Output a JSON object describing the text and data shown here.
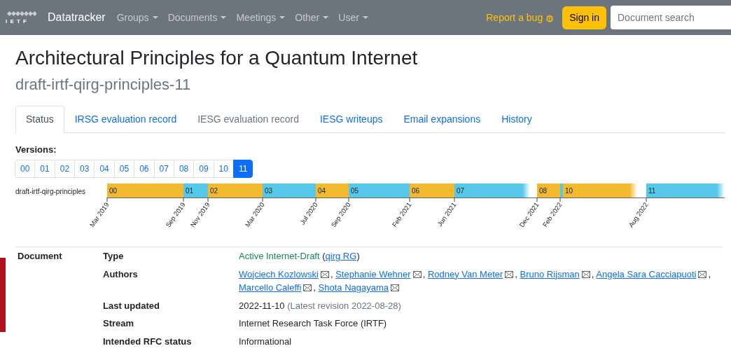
{
  "navbar": {
    "logo_text": "I E T F",
    "brand": "Datatracker",
    "menus": [
      "Groups",
      "Documents",
      "Meetings",
      "Other",
      "User"
    ],
    "report_bug": "Report a bug",
    "sign_in": "Sign in",
    "search": {
      "placeholder": "Document search"
    }
  },
  "title": "Architectural Principles for a Quantum Internet",
  "subtitle": "draft-irtf-qirg-principles-11",
  "tabs": [
    {
      "label": "Status",
      "selected": true,
      "disabled": false
    },
    {
      "label": "IRSG evaluation record",
      "selected": false,
      "disabled": false
    },
    {
      "label": "IESG evaluation record",
      "selected": false,
      "disabled": true
    },
    {
      "label": "IESG writeups",
      "selected": false,
      "disabled": false
    },
    {
      "label": "Email expansions",
      "selected": false,
      "disabled": false
    },
    {
      "label": "History",
      "selected": false,
      "disabled": false
    }
  ],
  "versions": {
    "label": "Versions:",
    "items": [
      {
        "label": "00",
        "selected": false
      },
      {
        "label": "01",
        "selected": false
      },
      {
        "label": "02",
        "selected": false
      },
      {
        "label": "03",
        "selected": false
      },
      {
        "label": "04",
        "selected": false
      },
      {
        "label": "05",
        "selected": false
      },
      {
        "label": "06",
        "selected": false
      },
      {
        "label": "07",
        "selected": false
      },
      {
        "label": "08",
        "selected": false
      },
      {
        "label": "09",
        "selected": false
      },
      {
        "label": "10",
        "selected": false
      },
      {
        "label": "11",
        "selected": true
      }
    ]
  },
  "timeline": {
    "name": "draft-irtf-qirg-principles",
    "segments": [
      {
        "label": "00",
        "color": "#f3ba2f",
        "fade": false
      },
      {
        "label": "01",
        "color": "#56c8ea",
        "fade": false
      },
      {
        "label": "02",
        "color": "#f3ba2f",
        "fade": false
      },
      {
        "label": "03",
        "color": "#56c8ea",
        "fade": false
      },
      {
        "label": "04",
        "color": "#f3ba2f",
        "fade": false
      },
      {
        "label": "05",
        "color": "#56c8ea",
        "fade": false
      },
      {
        "label": "06",
        "color": "#f3ba2f",
        "fade": false
      },
      {
        "label": "07",
        "color": "#56c8ea",
        "fade": true
      },
      {
        "label": "08",
        "color": "#f3ba2f",
        "fade": false
      },
      {
        "color": "#56c8ea"
      },
      {
        "label": "10",
        "color": "#f3ba2f",
        "fade": true
      },
      {
        "label": "11",
        "color": "#56c8ea",
        "fade": true
      }
    ],
    "ticks": [
      "Mar 2019",
      "Sep 2019",
      "Nov 2019",
      "Mar 2020",
      "Jul 2020",
      "Sep 2020",
      "Feb 2021",
      "Jun 2021",
      "Dec 2021",
      "Feb 2022",
      "Aug 2022"
    ]
  },
  "info": {
    "section": "Document",
    "rows": [
      {
        "kind": "type",
        "label": "Type",
        "parts": [
          {
            "kind": "status",
            "text": "Active Internet-Draft"
          },
          {
            "kind": "plain",
            "text": "("
          },
          {
            "kind": "link",
            "text": "qirg RG"
          },
          {
            "kind": "plain",
            "text": ")"
          }
        ]
      },
      {
        "kind": "authors",
        "label": "Authors",
        "authors": [
          {
            "name": "Wojciech Kozlowski",
            "sep": ","
          },
          {
            "name": "Stephanie Wehner",
            "sep": ","
          },
          {
            "name": "Rodney Van Meter",
            "sep": ","
          },
          {
            "name": "Bruno Rijsman",
            "sep": ","
          },
          {
            "name": "Angela Sara Cacciapuoti",
            "sep": ","
          },
          {
            "name": "Marcello Caleffi",
            "sep": ","
          },
          {
            "name": "Shota Nagayama"
          }
        ]
      },
      {
        "kind": "date",
        "label": "Last updated",
        "parts": [
          {
            "kind": "plain",
            "text": "2022-11-10"
          },
          {
            "kind": "muted",
            "text": "(Latest revision 2022-08-28)"
          }
        ]
      },
      {
        "kind": "text",
        "label": "Stream",
        "parts": [
          {
            "kind": "plain",
            "text": "Internet Research Task Force (IRTF)"
          }
        ]
      },
      {
        "kind": "text",
        "label": "Intended RFC status",
        "parts": [
          {
            "kind": "plain",
            "text": "Informational"
          }
        ]
      }
    ]
  }
}
